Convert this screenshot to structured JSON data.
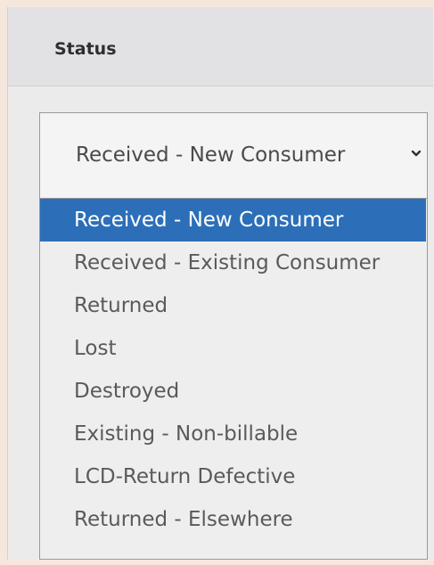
{
  "form": {
    "status_label": "Status"
  },
  "status_select": {
    "value": "Received - New Consumer",
    "chevron_icon": "chevron-down-icon",
    "options": [
      {
        "label": "Received - New Consumer",
        "selected": true
      },
      {
        "label": "Received - Existing Consumer",
        "selected": false
      },
      {
        "label": "Returned",
        "selected": false
      },
      {
        "label": "Lost",
        "selected": false
      },
      {
        "label": "Destroyed",
        "selected": false
      },
      {
        "label": "Existing - Non-billable",
        "selected": false
      },
      {
        "label": "LCD-Return Defective",
        "selected": false
      },
      {
        "label": "Returned - Elsewhere",
        "selected": false
      }
    ]
  },
  "colors": {
    "selected_option_bg": "#2c6fb8",
    "selected_option_text": "#ffffff"
  }
}
